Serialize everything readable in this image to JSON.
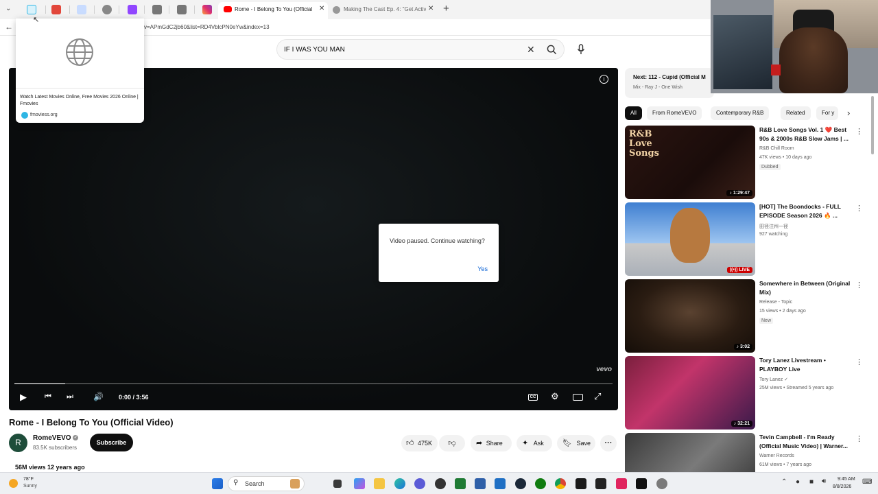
{
  "browser": {
    "tabs": [
      {
        "icon": "grid-icon",
        "color": "#2fb6e4"
      },
      {
        "icon": "app-icon",
        "color": "#e2473b"
      },
      {
        "icon": "app-icon",
        "color": "#4f86e8"
      },
      {
        "icon": "globe-icon",
        "color": "#777777"
      },
      {
        "icon": "twitch-icon",
        "color": "#9146ff"
      },
      {
        "icon": "page-icon",
        "color": "#666666"
      },
      {
        "icon": "page-icon",
        "color": "#666666"
      },
      {
        "icon": "instagram-icon",
        "color": "#e1306c"
      }
    ],
    "active_tab_title": "Rome - I Belong To You (Official V",
    "other_tab_title": "Making The Cast Ep. 4: \"Get Activ",
    "url": "v=APmGdC2jb60&list=RD4VblcPN0eYw&index=13"
  },
  "hover_card": {
    "title": "Watch Latest Movies Online, Free Movies 2026 Online | Fmovies",
    "domain": "fmoviess.org"
  },
  "search": {
    "query": "IF I WAS YOU MAN"
  },
  "player": {
    "time": "0:00 / 3:56",
    "watermark": "vevo",
    "progress_buffered_fraction": 0.085,
    "pause_dialog": {
      "message": "Video paused. Continue watching?",
      "confirm": "Yes"
    }
  },
  "video": {
    "title": "Rome - I Belong To You (Official Video)",
    "channel": "RomeVEVO",
    "channel_initial": "R",
    "subscribers": "83.5K subscribers",
    "subscribe_label": "Subscribe",
    "likes": "475K",
    "share_label": "Share",
    "ask_label": "Ask",
    "save_label": "Save",
    "views_line": "56M views  12 years ago"
  },
  "up_next": {
    "title": "Next: 112 - Cupid (Official M",
    "subtitle": "Mix - Ray J - One Wish"
  },
  "chips": [
    "All",
    "From RomeVEVO",
    "Contemporary R&B",
    "Related",
    "For y"
  ],
  "recommendations": [
    {
      "title": "R&B Love Songs Vol. 1 ❤️ Best 90s & 2000s R&B Slow Jams | ...",
      "channel": "R&B Chill Room",
      "meta": "47K views • 10 days ago",
      "badge": "Dubbed",
      "duration": "♪ 1:29:47",
      "thumb_text": "R&B Love Songs"
    },
    {
      "title": "[HOT] The Boondocks - FULL EPISODE Season 2026 🔥 ...",
      "channel": "田径注州一径",
      "meta": "927 watching",
      "badge": "",
      "duration": "((•)) LIVE",
      "thumb_text": ""
    },
    {
      "title": "Somewhere in Between (Original Mix)",
      "channel": "Release - Topic",
      "meta": "15 views • 2 days ago",
      "badge": "New",
      "duration": "♪ 3:02",
      "thumb_text": ""
    },
    {
      "title": "Tory Lanez Livestream • PLAYBOY Live",
      "channel": "Tory Lanez ✓",
      "meta": "25M views • Streamed 5 years ago",
      "badge": "",
      "duration": "♪ 32:21",
      "thumb_text": ""
    },
    {
      "title": "Tevin Campbell - I'm Ready (Official Music Video) | Warner...",
      "channel": "Warner Records",
      "meta": "61M views • 7 years ago",
      "badge": "",
      "duration": "",
      "thumb_text": ""
    }
  ],
  "taskbar": {
    "weather_temp": "78°F",
    "weather_desc": "Sunny",
    "search_label": "Search",
    "time": "9:45 AM",
    "date": "8/8/2026"
  }
}
